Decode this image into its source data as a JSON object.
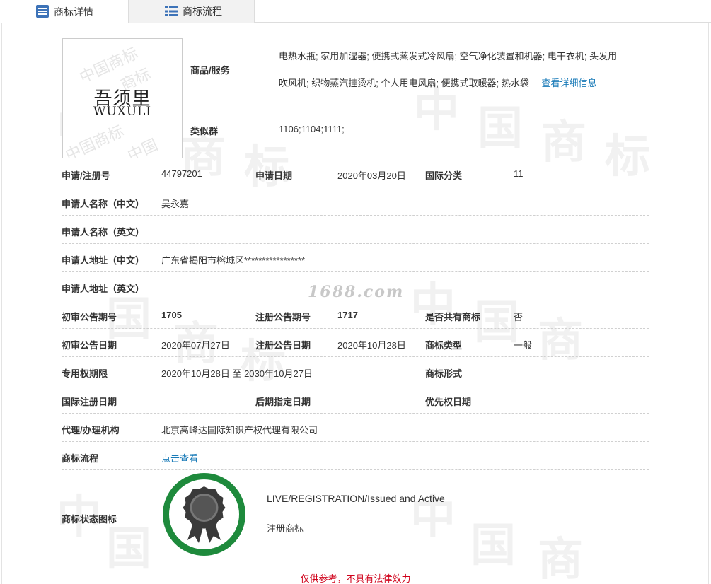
{
  "tabs": [
    {
      "label": "商标详情",
      "icon": "detail-list-icon"
    },
    {
      "label": "商标流程",
      "icon": "grid-list-icon"
    }
  ],
  "logo": {
    "cn": "吾须里",
    "en": "WUXULI"
  },
  "goods": {
    "label": "商品/服务",
    "line1": "电热水瓶; 家用加湿器; 便携式蒸发式冷风扇; 空气净化装置和机器; 电干衣机; 头发用",
    "line2": "吹风机; 织物蒸汽挂烫机; 个人用电风扇; 便携式取暖器; 热水袋",
    "more_link": "查看详细信息"
  },
  "similar_group": {
    "label": "类似群",
    "value": "1106;1104;1111;"
  },
  "fields": {
    "reg_no_label": "申请/注册号",
    "reg_no": "44797201",
    "apply_date_label": "申请日期",
    "apply_date": "2020年03月20日",
    "intl_class_label": "国际分类",
    "intl_class": "11",
    "applicant_cn_label": "申请人名称（中文）",
    "applicant_cn": "吴永嘉",
    "applicant_en_label": "申请人名称（英文）",
    "applicant_en": "",
    "address_cn_label": "申请人地址（中文）",
    "address_cn": "广东省揭阳市榕城区*****************",
    "address_en_label": "申请人地址（英文）",
    "address_en": "",
    "prelim_no_label": "初审公告期号",
    "prelim_no": "1705",
    "reg_pub_no_label": "注册公告期号",
    "reg_pub_no": "1717",
    "shared_label": "是否共有商标",
    "shared": "否",
    "prelim_date_label": "初审公告日期",
    "prelim_date": "2020年07月27日",
    "reg_pub_date_label": "注册公告日期",
    "reg_pub_date": "2020年10月28日",
    "tm_type_label": "商标类型",
    "tm_type": "一般",
    "exclusive_label": "专用权期限",
    "exclusive": "2020年10月28日 至 2030年10月27日",
    "tm_form_label": "商标形式",
    "tm_form": "",
    "intl_reg_date_label": "国际注册日期",
    "intl_reg_date": "",
    "later_date_label": "后期指定日期",
    "later_date": "",
    "priority_date_label": "优先权日期",
    "priority_date": "",
    "agent_label": "代理/办理机构",
    "agent": "北京高峰达国际知识产权代理有限公司",
    "process_label": "商标流程",
    "process_link": "点击查看",
    "status_label": "商标状态图标",
    "status_en": "LIVE/REGISTRATION/Issued and Active",
    "status_cn": "注册商标"
  },
  "site_watermark": "1688.com",
  "notice": "仅供参考，不具有法律效力",
  "colors": {
    "link": "#1a7bb8",
    "status_green": "#1e8a3c",
    "notice_red": "#d0021b"
  }
}
